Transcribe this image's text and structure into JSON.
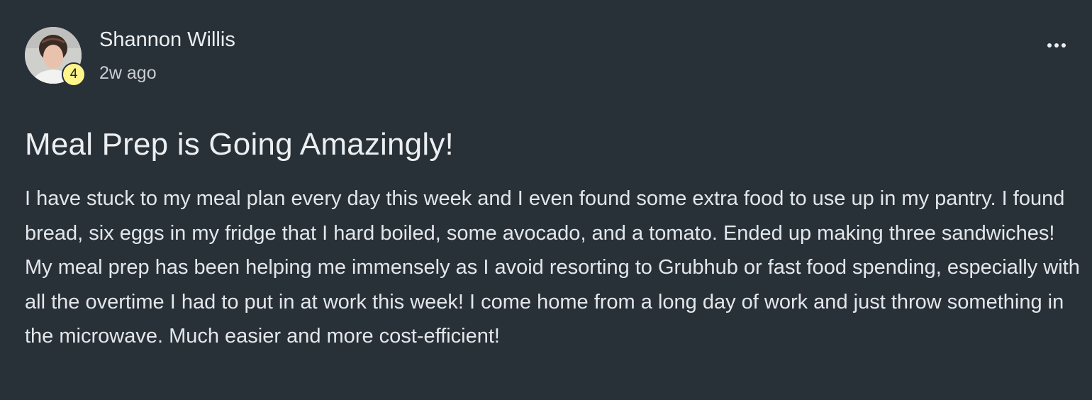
{
  "post": {
    "author": {
      "name": "Shannon Willis",
      "level": "4"
    },
    "timestamp": "2w ago",
    "menu_icon": "more-horizontal-icon",
    "title": "Meal Prep is Going Amazingly!",
    "body": "I have stuck to my meal plan every day this week and I even found some extra food to use up in my pantry. I found bread, six eggs in my fridge that I hard boiled, some avocado, and a tomato. Ended up making three sandwiches! My meal prep has been helping me immensely as I avoid resorting to Grubhub or fast food spending, especially with all the overtime I had to put in at work this week! I come home from a long day of work and just throw something in the microwave. Much easier and more cost-efficient!"
  },
  "colors": {
    "background": "#283038",
    "text": "#eceff1",
    "badge": "#fff58a"
  }
}
